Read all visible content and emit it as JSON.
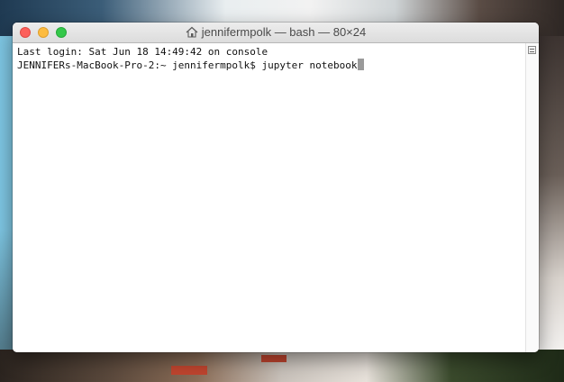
{
  "window": {
    "title": "jennifermpolk — bash — 80×24",
    "title_icon": "home-icon"
  },
  "terminal": {
    "lines": [
      "Last login: Sat Jun 18 14:49:42 on console",
      "JENNIFERs-MacBook-Pro-2:~ jennifermpolk$ jupyter notebook"
    ]
  },
  "colors": {
    "close": "#fc605b",
    "minimize": "#fdbc40",
    "zoom": "#34c84a",
    "terminal_bg": "#ffffff",
    "terminal_text": "#111111"
  }
}
